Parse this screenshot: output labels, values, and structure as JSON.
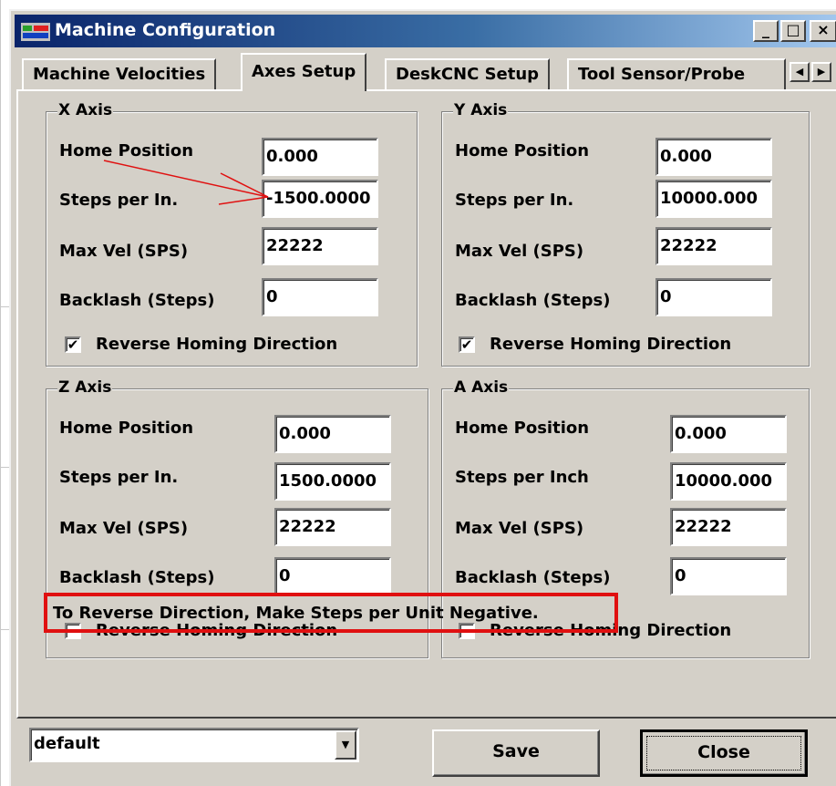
{
  "window": {
    "title": "Machine Configuration",
    "controls": {
      "minimize": "_",
      "maximize": "□",
      "close": "×"
    }
  },
  "tabs": [
    {
      "label": "Machine Velocities",
      "active": false
    },
    {
      "label": "Axes Setup",
      "active": true
    },
    {
      "label": "DeskCNC Setup",
      "active": false
    },
    {
      "label": "Tool Sensor/Probe",
      "active": false
    }
  ],
  "tab_scroll": {
    "left": "◀",
    "right": "▶"
  },
  "axes": {
    "x": {
      "title": "X Axis",
      "home_label": "Home Position",
      "home_value": "0.000",
      "steps_label": "Steps per In.",
      "steps_value": "-1500.0000",
      "maxvel_label": "Max Vel (SPS)",
      "maxvel_value": "22222",
      "backlash_label": "Backlash (Steps)",
      "backlash_value": "0",
      "reverse_label": "Reverse Homing Direction",
      "reverse_checked": true
    },
    "y": {
      "title": "Y Axis",
      "home_label": "Home Position",
      "home_value": "0.000",
      "steps_label": "Steps per In.",
      "steps_value": "10000.000",
      "maxvel_label": "Max Vel (SPS)",
      "maxvel_value": "22222",
      "backlash_label": "Backlash (Steps)",
      "backlash_value": "0",
      "reverse_label": "Reverse Homing Direction",
      "reverse_checked": true
    },
    "z": {
      "title": "Z Axis",
      "home_label": "Home Position",
      "home_value": "0.000",
      "steps_label": "Steps per In.",
      "steps_value": "1500.0000",
      "maxvel_label": "Max Vel (SPS)",
      "maxvel_value": "22222",
      "backlash_label": "Backlash (Steps)",
      "backlash_value": "0",
      "reverse_label": "Reverse Homing Direction",
      "reverse_checked": false
    },
    "a": {
      "title": "A Axis",
      "home_label": "Home Position",
      "home_value": "0.000",
      "steps_label": "Steps per Inch",
      "steps_value": "10000.000",
      "maxvel_label": "Max Vel (SPS)",
      "maxvel_value": "22222",
      "backlash_label": "Backlash (Steps)",
      "backlash_value": "0",
      "reverse_label": "Reverse Homing Direction",
      "reverse_checked": false
    }
  },
  "note": "To Reverse Direction, Make Steps per Unit Negative.",
  "profile_select": {
    "value": "default",
    "arrow": "▼"
  },
  "buttons": {
    "save": "Save",
    "close": "Close"
  },
  "colors": {
    "highlight": "#e01010",
    "panel": "#d4d0c8",
    "title_start": "#0a246a",
    "title_end": "#a6caf0"
  }
}
